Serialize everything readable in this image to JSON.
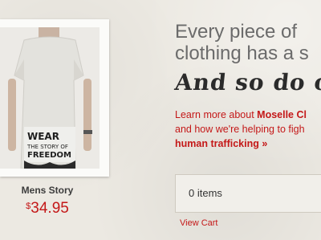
{
  "product": {
    "name": "Mens Story",
    "price_currency": "$",
    "price_amount": "34.95",
    "shirt_print": "WEAR THE STORY OF FREEDOM"
  },
  "hero": {
    "tagline_line1": "Every piece of",
    "tagline_line2": "clothing has a s",
    "script_line": "And so do o",
    "learn_prefix": "Learn more about ",
    "learn_brand": "Moselle Cl",
    "learn_mid": "and how we're helping to figh",
    "learn_link": "human trafficking »"
  },
  "cart": {
    "count_text": "0 items",
    "view_cart_label": "View Cart"
  },
  "colors": {
    "accent_red": "#c41818",
    "background": "#ece9e2"
  }
}
